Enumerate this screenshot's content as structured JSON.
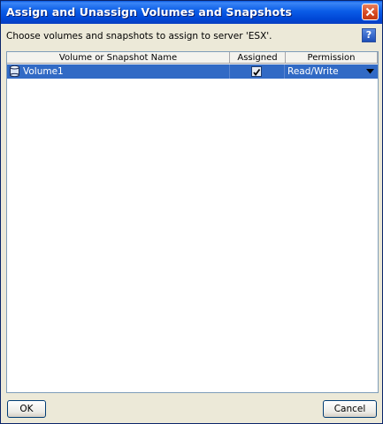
{
  "window": {
    "title": "Assign and Unassign Volumes and Snapshots",
    "close_icon": "close-icon"
  },
  "prompt": {
    "text": "Choose volumes and snapshots to assign to server 'ESX'.",
    "help_label": "?"
  },
  "table": {
    "columns": [
      "Volume or Snapshot Name",
      "Assigned",
      "Permission"
    ],
    "rows": [
      {
        "icon": "database-icon",
        "name": "Volume1",
        "assigned": true,
        "permission": "Read/Write",
        "selected": true
      }
    ]
  },
  "buttons": {
    "ok": "OK",
    "cancel": "Cancel"
  },
  "colors": {
    "titlebar": "#0a5ce7",
    "selection": "#316ac5",
    "dialog_bg": "#ece9d8"
  }
}
